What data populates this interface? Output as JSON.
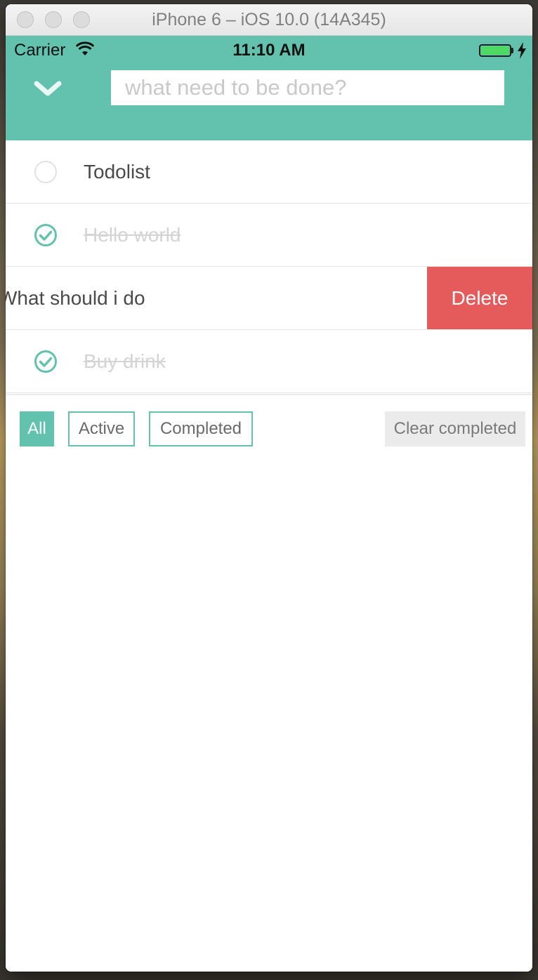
{
  "window": {
    "title": "iPhone 6 – iOS 10.0 (14A345)"
  },
  "status_bar": {
    "carrier": "Carrier",
    "time": "11:10 AM",
    "battery_level": 1.0,
    "battery_color": "#4cd964"
  },
  "header": {
    "toggle_icon": "chevron-down-icon",
    "input_placeholder": "what need to be done?",
    "input_value": "",
    "accent_color": "#62c2ad"
  },
  "todos": [
    {
      "label": "Todolist",
      "completed": false
    },
    {
      "label": "Hello world",
      "completed": true
    },
    {
      "label": "What should i do",
      "completed": false,
      "swiped": true,
      "action_label": "Delete",
      "action_color": "#e55a5b"
    },
    {
      "label": "Buy drink",
      "completed": true
    }
  ],
  "footer": {
    "filters": [
      {
        "label": "All",
        "selected": true
      },
      {
        "label": "Active",
        "selected": false
      },
      {
        "label": "Completed",
        "selected": false
      }
    ],
    "clear_label": "Clear completed"
  }
}
